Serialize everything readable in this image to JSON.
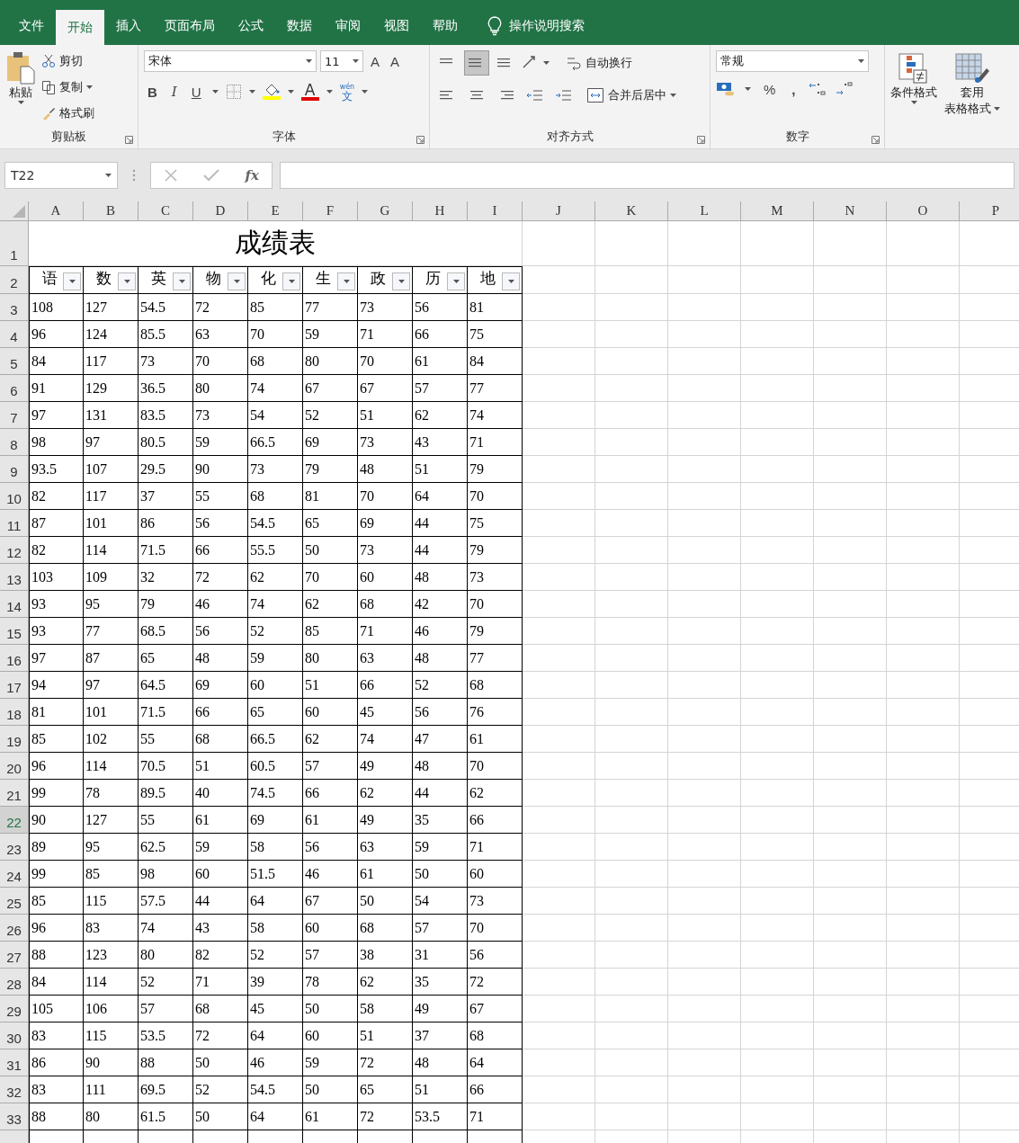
{
  "menu_tabs": [
    {
      "label": "文件",
      "selected": false
    },
    {
      "label": "开始",
      "selected": true
    },
    {
      "label": "插入",
      "selected": false
    },
    {
      "label": "页面布局",
      "selected": false
    },
    {
      "label": "公式",
      "selected": false
    },
    {
      "label": "数据",
      "selected": false
    },
    {
      "label": "审阅",
      "selected": false
    },
    {
      "label": "视图",
      "selected": false
    },
    {
      "label": "帮助",
      "selected": false
    }
  ],
  "tell_me": "操作说明搜索",
  "clipboard": {
    "paste": "粘贴",
    "cut": "剪切",
    "copy": "复制",
    "format_painter": "格式刷",
    "label": "剪贴板"
  },
  "font": {
    "font_name": "宋体",
    "font_size": "11",
    "grow": "A",
    "shrink": "A",
    "bold": "B",
    "italic": "I",
    "underline": "U",
    "font_color": "A",
    "phonetic_top": "wén",
    "phonetic_bottom": "文",
    "label": "字体"
  },
  "alignment": {
    "wrap_text": "自动换行",
    "merge_center": "合并后居中",
    "label": "对齐方式"
  },
  "number": {
    "format": "常规",
    "percent": "%",
    "comma": ",",
    "label": "数字"
  },
  "styles": {
    "conditional": "条件格式",
    "table_top": "套用",
    "table_bottom": "表格格式"
  },
  "formula_bar": {
    "name_box": "T22",
    "fx": "fx"
  },
  "columns": [
    "A",
    "B",
    "C",
    "D",
    "E",
    "F",
    "G",
    "H",
    "I",
    "J",
    "K",
    "L",
    "M",
    "N",
    "O",
    "P"
  ],
  "title": {
    "row": "1",
    "text": "成绩表"
  },
  "header_row": {
    "row": "2",
    "cells": [
      "语",
      "数",
      "英",
      "物",
      "化",
      "生",
      "政",
      "历",
      "地"
    ]
  },
  "rows": [
    {
      "row": "3",
      "selected": false,
      "cells": [
        "108",
        "127",
        "54.5",
        "72",
        "85",
        "77",
        "73",
        "56",
        "81"
      ]
    },
    {
      "row": "4",
      "selected": false,
      "cells": [
        "96",
        "124",
        "85.5",
        "63",
        "70",
        "59",
        "71",
        "66",
        "75"
      ]
    },
    {
      "row": "5",
      "selected": false,
      "cells": [
        "84",
        "117",
        "73",
        "70",
        "68",
        "80",
        "70",
        "61",
        "84"
      ]
    },
    {
      "row": "6",
      "selected": false,
      "cells": [
        "91",
        "129",
        "36.5",
        "80",
        "74",
        "67",
        "67",
        "57",
        "77"
      ]
    },
    {
      "row": "7",
      "selected": false,
      "cells": [
        "97",
        "131",
        "83.5",
        "73",
        "54",
        "52",
        "51",
        "62",
        "74"
      ]
    },
    {
      "row": "8",
      "selected": false,
      "cells": [
        "98",
        "97",
        "80.5",
        "59",
        "66.5",
        "69",
        "73",
        "43",
        "71"
      ]
    },
    {
      "row": "9",
      "selected": false,
      "cells": [
        "93.5",
        "107",
        "29.5",
        "90",
        "73",
        "79",
        "48",
        "51",
        "79"
      ]
    },
    {
      "row": "10",
      "selected": false,
      "cells": [
        "82",
        "117",
        "37",
        "55",
        "68",
        "81",
        "70",
        "64",
        "70"
      ]
    },
    {
      "row": "11",
      "selected": false,
      "cells": [
        "87",
        "101",
        "86",
        "56",
        "54.5",
        "65",
        "69",
        "44",
        "75"
      ]
    },
    {
      "row": "12",
      "selected": false,
      "cells": [
        "82",
        "114",
        "71.5",
        "66",
        "55.5",
        "50",
        "73",
        "44",
        "79"
      ]
    },
    {
      "row": "13",
      "selected": false,
      "cells": [
        "103",
        "109",
        "32",
        "72",
        "62",
        "70",
        "60",
        "48",
        "73"
      ]
    },
    {
      "row": "14",
      "selected": false,
      "cells": [
        "93",
        "95",
        "79",
        "46",
        "74",
        "62",
        "68",
        "42",
        "70"
      ]
    },
    {
      "row": "15",
      "selected": false,
      "cells": [
        "93",
        "77",
        "68.5",
        "56",
        "52",
        "85",
        "71",
        "46",
        "79"
      ]
    },
    {
      "row": "16",
      "selected": false,
      "cells": [
        "97",
        "87",
        "65",
        "48",
        "59",
        "80",
        "63",
        "48",
        "77"
      ]
    },
    {
      "row": "17",
      "selected": false,
      "cells": [
        "94",
        "97",
        "64.5",
        "69",
        "60",
        "51",
        "66",
        "52",
        "68"
      ]
    },
    {
      "row": "18",
      "selected": false,
      "cells": [
        "81",
        "101",
        "71.5",
        "66",
        "65",
        "60",
        "45",
        "56",
        "76"
      ]
    },
    {
      "row": "19",
      "selected": false,
      "cells": [
        "85",
        "102",
        "55",
        "68",
        "66.5",
        "62",
        "74",
        "47",
        "61"
      ]
    },
    {
      "row": "20",
      "selected": false,
      "cells": [
        "96",
        "114",
        "70.5",
        "51",
        "60.5",
        "57",
        "49",
        "48",
        "70"
      ]
    },
    {
      "row": "21",
      "selected": false,
      "cells": [
        "99",
        "78",
        "89.5",
        "40",
        "74.5",
        "66",
        "62",
        "44",
        "62"
      ]
    },
    {
      "row": "22",
      "selected": true,
      "cells": [
        "90",
        "127",
        "55",
        "61",
        "69",
        "61",
        "49",
        "35",
        "66"
      ]
    },
    {
      "row": "23",
      "selected": false,
      "cells": [
        "89",
        "95",
        "62.5",
        "59",
        "58",
        "56",
        "63",
        "59",
        "71"
      ]
    },
    {
      "row": "24",
      "selected": false,
      "cells": [
        "99",
        "85",
        "98",
        "60",
        "51.5",
        "46",
        "61",
        "50",
        "60"
      ]
    },
    {
      "row": "25",
      "selected": false,
      "cells": [
        "85",
        "115",
        "57.5",
        "44",
        "64",
        "67",
        "50",
        "54",
        "73"
      ]
    },
    {
      "row": "26",
      "selected": false,
      "cells": [
        "96",
        "83",
        "74",
        "43",
        "58",
        "60",
        "68",
        "57",
        "70"
      ]
    },
    {
      "row": "27",
      "selected": false,
      "cells": [
        "88",
        "123",
        "80",
        "82",
        "52",
        "57",
        "38",
        "31",
        "56"
      ]
    },
    {
      "row": "28",
      "selected": false,
      "cells": [
        "84",
        "114",
        "52",
        "71",
        "39",
        "78",
        "62",
        "35",
        "72"
      ]
    },
    {
      "row": "29",
      "selected": false,
      "cells": [
        "105",
        "106",
        "57",
        "68",
        "45",
        "50",
        "58",
        "49",
        "67"
      ]
    },
    {
      "row": "30",
      "selected": false,
      "cells": [
        "83",
        "115",
        "53.5",
        "72",
        "64",
        "60",
        "51",
        "37",
        "68"
      ]
    },
    {
      "row": "31",
      "selected": false,
      "cells": [
        "86",
        "90",
        "88",
        "50",
        "46",
        "59",
        "72",
        "48",
        "64"
      ]
    },
    {
      "row": "32",
      "selected": false,
      "cells": [
        "83",
        "111",
        "69.5",
        "52",
        "54.5",
        "50",
        "65",
        "51",
        "66"
      ]
    },
    {
      "row": "33",
      "selected": false,
      "cells": [
        "88",
        "80",
        "61.5",
        "50",
        "64",
        "61",
        "72",
        "53.5",
        "71"
      ]
    }
  ]
}
